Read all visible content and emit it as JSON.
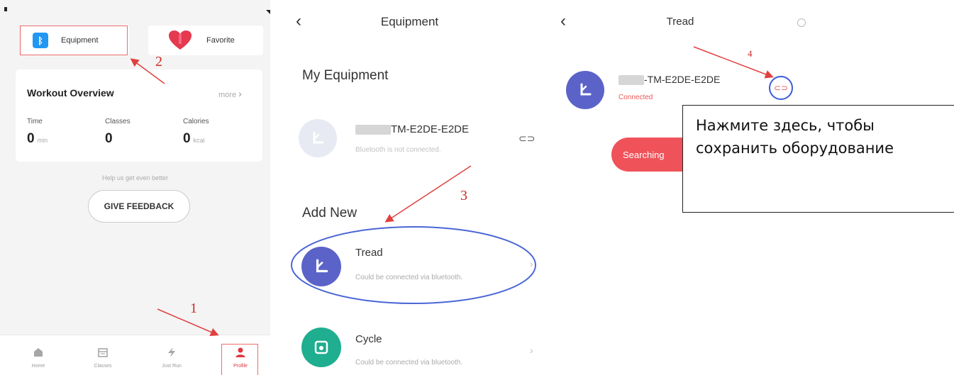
{
  "panel1": {
    "tiles": {
      "equipment": "Equipment",
      "favorite": "Favorite"
    },
    "overview": {
      "title": "Workout Overview",
      "more": "more",
      "stats": [
        {
          "label": "Time",
          "value": "0",
          "unit": "min"
        },
        {
          "label": "Classes",
          "value": "0",
          "unit": ""
        },
        {
          "label": "Calories",
          "value": "0",
          "unit": "kcal"
        }
      ]
    },
    "help_text": "Help us get even better",
    "feedback_button": "GIVE FEEDBACK",
    "tabs": [
      "Home",
      "Classes",
      "Just Run",
      "Profile"
    ],
    "step_numbers": [
      "1",
      "2"
    ]
  },
  "panel2": {
    "title": "Equipment",
    "my_equipment": "My Equipment",
    "saved_device": {
      "name": "TM-E2DE-E2DE",
      "status": "Bluetooth is not connected."
    },
    "add_new": "Add New",
    "items": [
      {
        "name": "Tread",
        "sub": "Could be connected via bluetooth."
      },
      {
        "name": "Cycle",
        "sub": "Could be connected via bluetooth."
      }
    ],
    "step_number": "3"
  },
  "panel3": {
    "title": "Tread",
    "device": {
      "name": "-TM-E2DE-E2DE",
      "status": "Connected"
    },
    "searching_button": "Searching",
    "tooltip": "Нажмите здесь, чтобы сохранить оборудование",
    "step_number": "4"
  },
  "colors": {
    "accent_blue": "#3b5bdb",
    "tread_purple": "#5b63c9",
    "cycle_green": "#1fae8f",
    "annotation_red": "#e04040",
    "search_red": "#f0525a"
  }
}
